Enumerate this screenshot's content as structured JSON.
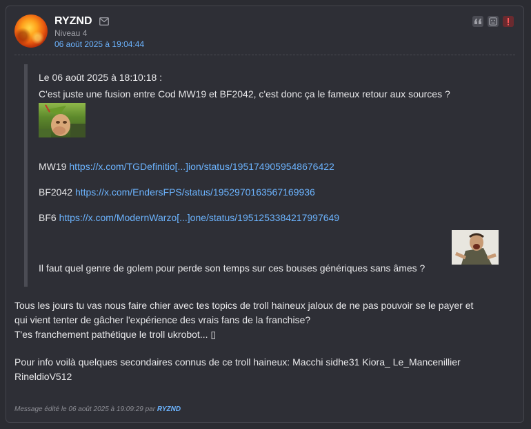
{
  "post": {
    "username": "RYZND",
    "level": "Niveau 4",
    "date": "06 août 2025 à 19:04:44",
    "quote": {
      "header": "Le 06 août 2025 à 18:10:18 :",
      "line1": "C'est juste une fusion entre Cod MW19 et BF2042, c'est donc ça le fameux retour aux sources ?",
      "mw19_label": "MW19",
      "mw19_link": "https://x.com/TGDefinitio[...]ion/status/1951749059548676422",
      "bf2042_label": "BF2042",
      "bf2042_link": "https://x.com/EndersFPS/status/1952970163567169936",
      "bf6_label": "BF6",
      "bf6_link": "https://x.com/ModernWarzo[...]one/status/1951253384217997649",
      "closing": "Il faut quel genre de golem pour perde son temps sur ces bouses génériques sans âmes ?"
    },
    "paragraph1_line1": "Tous les jours tu vas nous faire chier avec tes topics de troll haineux jaloux de ne pas pouvoir se le payer et",
    "paragraph1_line2": "qui vient tenter de gâcher l'expérience des vrais fans de la franchise?",
    "paragraph1_line3": "T'es franchement pathétique le troll ukrobot... ▯",
    "paragraph2_line1": "Pour info voilà quelques secondaires connus de ce troll haineux: Macchi sidhe31 Kiora_ Le_Mancenillier",
    "paragraph2_line2": "RineldioV512",
    "edited_prefix": "Message édité le 06 août 2025 à 19:09:29 par",
    "edited_by": "RYZND",
    "icons": [
      "mail-icon",
      "quote-icon",
      "ignore-icon",
      "report-icon"
    ],
    "colors": {
      "link": "#6cb4ff",
      "background": "#2e2f36",
      "alert": "#6b2a2f"
    }
  }
}
